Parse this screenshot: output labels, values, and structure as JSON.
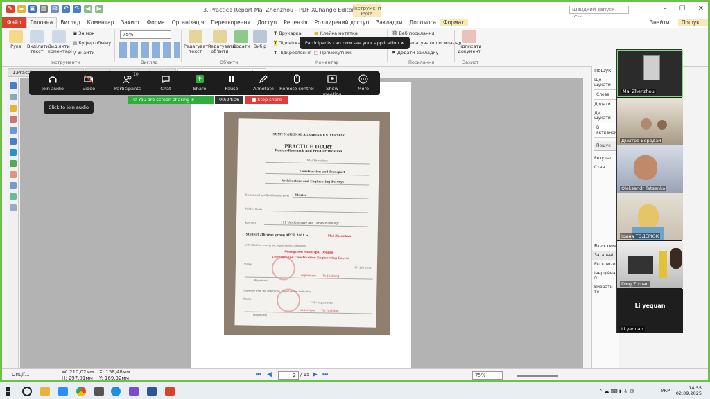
{
  "window": {
    "title": "3. Practice Report Mai Zhenzhou - PDF-XChange Editor",
    "context_tab": "Інструмент Рука",
    "quick_search": "Швидкий запуск (Ctrl..."
  },
  "menu": {
    "file": "Файл",
    "items": [
      "Головна",
      "Вигляд",
      "Коментар",
      "Захист",
      "Форма",
      "Організація",
      "Перетворення",
      "Доступ",
      "Рецензія",
      "Розширений доступ",
      "Закладки",
      "Допомога",
      "Формат"
    ],
    "right_items": [
      "Знайти...",
      "Пошук..."
    ]
  },
  "ribbon": {
    "hand": "Рука",
    "select_text": "Виділити текст",
    "select_comments": "Виділити коментарі",
    "snapshot": "Знімок",
    "clipboard": "Буфер обміну",
    "find": "Знайти",
    "zoom_value": "75%",
    "edit_text": "Редагувати текст",
    "edit_objects": "Редагувати об'єкти",
    "add": "Додати",
    "choose": "Вибір",
    "typewriter": "Друкарка",
    "sticky_note": "Клейка нотатка",
    "highlight": "Підсвітка",
    "underline": "Підкреслення",
    "rectangle": "Прямокутник",
    "web_links": "Веб посилання",
    "edit_links": "Редагувати посилання",
    "add_bookmark": "Додати закладку",
    "sign_document": "Підписати документ",
    "sections": {
      "tools": "Інструменти",
      "view": "Вигляд",
      "objects": "Об'єкти",
      "comment": "Коментар",
      "links": "Посилання",
      "protect": "Захист"
    }
  },
  "document_tabs": [
    "1.Practice Report Li Yequan",
    "2. Practice Report Zhu Zhuoxiang",
    "3. Practice Report Mai Zhenzhou"
  ],
  "document": {
    "university": "SUMY NATIONAL AGRARIAN UNIVERSITY",
    "heading": "PRACTICE DIARY",
    "subheading": "Design-Research and Pre-Certification",
    "student_hand": "Mai Zhenzhou",
    "institute_value": "Construction and Transport",
    "department_value": "Architecture and Engineering Surveys",
    "level_label": "Educational and Qualification Level",
    "level_value": "Master",
    "field_label": "Field of Study",
    "specialty_label": "Specialty",
    "specialty_value": "191 \"Architecture and Urban Planning\"",
    "student_line": "Student  2th-year,   group  APCH 2401 м",
    "student_red": "Mai Zhenzhou",
    "arrived": "Arrived at the enterprise, organization, institution",
    "enterprise1": "Guangzhou Municipal Donjun",
    "enterprise2": "Underground Construction Engineering Co.,Ltd",
    "stamp_label": "Stamp",
    "supervisor": "supervisor",
    "supervisor_name": "Ye Junliang",
    "date1": "\"01\" July 2025",
    "departed": "Departed from the enterprise, organization, institution",
    "date2": "\"31\" August 2025",
    "signature": "(Signature)"
  },
  "search_panel": {
    "title": "Пошук",
    "what": "Що шукати",
    "words": "Слова",
    "add": "Додати",
    "where": "Де шукати",
    "active": "В активному",
    "search_btn": "Пошук",
    "results": "Результ...",
    "status": "Стан"
  },
  "props_panel": {
    "title": "Властивості",
    "general": "Загальні",
    "exclusive": "Ексклюзивн",
    "inertial": "Інерційна п",
    "choose": "Вибрати те"
  },
  "status": {
    "options": "Опції...",
    "width": "W: 210,02мм",
    "height": "H: 297,01мм",
    "x": "X: 158,48мм",
    "y": "Y: 169,32мм",
    "page": "2",
    "page_total": "/ 15",
    "zoom": "75%"
  },
  "zoom_meeting": {
    "toolbar": [
      "Join audio",
      "Video",
      "Participants",
      "Chat",
      "Share",
      "Pause",
      "Annotate",
      "Remote control",
      "Show meeting",
      "More"
    ],
    "participants_count": "10",
    "tooltip": "Click to join audio",
    "sharing_text": "You are screen sharing",
    "timer": "00:24:06",
    "stop_share": "Stop share",
    "notice": "Participants can now see your application",
    "participants": [
      "Mai Zhenzhou",
      "Дмитро Бородай",
      "Oleksandr Tatsenko",
      "Ірина ТОДЕРЮК",
      "Ding Zixuan",
      "Li yequan"
    ],
    "big_name": "Li yequan"
  },
  "taskbar": {
    "language": "УКР",
    "time": "14:55",
    "date": "02.09.2025"
  },
  "colors": {
    "frame_green": "#6fc04a",
    "file_red": "#d9432c",
    "share_green": "#2fae3f",
    "stop_red": "#e33a3a"
  }
}
